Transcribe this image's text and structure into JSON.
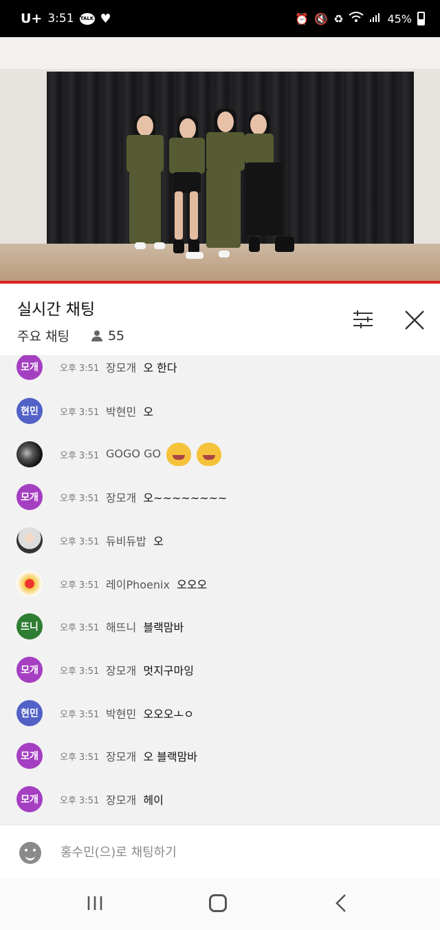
{
  "status_bar": {
    "carrier": "U+",
    "time": "3:51",
    "talk_badge": "TALK",
    "battery": "45%"
  },
  "chat": {
    "title": "실시간 채팅",
    "mode": "주요 채팅",
    "viewer_count": "55",
    "messages": [
      {
        "avatar_text": "모개",
        "avatar_color": "#a53fc2",
        "time": "오후 3:51",
        "author": "장모개",
        "text": "오 한다"
      },
      {
        "avatar_text": "현민",
        "avatar_color": "#5161c5",
        "time": "오후 3:51",
        "author": "박현민",
        "text": "오"
      },
      {
        "avatar_text": "",
        "avatar_color": "#2b2b2b",
        "time": "오후 3:51",
        "author": "GOGO GO",
        "text": ""
      },
      {
        "avatar_text": "모개",
        "avatar_color": "#a53fc2",
        "time": "오후 3:51",
        "author": "장모개",
        "text": "오~~~~~~~~"
      },
      {
        "avatar_text": "",
        "avatar_color": "#d9cfc6",
        "time": "오후 3:51",
        "author": "듀비듀밥",
        "text": "오"
      },
      {
        "avatar_text": "",
        "avatar_color": "#f0c040",
        "time": "오후 3:51",
        "author": "레이Phoenix",
        "text": "오오오"
      },
      {
        "avatar_text": "뜨니",
        "avatar_color": "#2e7d32",
        "time": "오후 3:51",
        "author": "해뜨니",
        "text": "블랙맘바"
      },
      {
        "avatar_text": "모개",
        "avatar_color": "#a53fc2",
        "time": "오후 3:51",
        "author": "장모개",
        "text": "멋지구마잉"
      },
      {
        "avatar_text": "현민",
        "avatar_color": "#5161c5",
        "time": "오후 3:51",
        "author": "박현민",
        "text": "오오오ㅗㅇ"
      },
      {
        "avatar_text": "모개",
        "avatar_color": "#a53fc2",
        "time": "오후 3:51",
        "author": "장모개",
        "text": "오 블랙맘바"
      },
      {
        "avatar_text": "모개",
        "avatar_color": "#a53fc2",
        "time": "오후 3:51",
        "author": "장모개",
        "text": "헤이"
      }
    ],
    "input_placeholder": "홍수민(으)로 채팅하기"
  }
}
